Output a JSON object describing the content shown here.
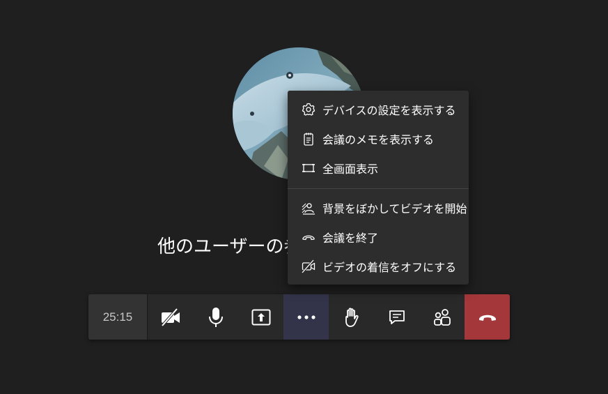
{
  "call": {
    "waiting_text": "他のユーザーの参",
    "timer": "25:15"
  },
  "toolbar": {
    "buttons": [
      {
        "name": "camera-off-button",
        "icon": "video-off-icon"
      },
      {
        "name": "microphone-button",
        "icon": "microphone-icon"
      },
      {
        "name": "share-screen-button",
        "icon": "share-screen-icon"
      },
      {
        "name": "more-actions-button",
        "icon": "more-dots-icon",
        "active": true
      },
      {
        "name": "raise-hand-button",
        "icon": "hand-icon"
      },
      {
        "name": "chat-button",
        "icon": "chat-icon"
      },
      {
        "name": "participants-button",
        "icon": "participants-icon"
      },
      {
        "name": "hang-up-button",
        "icon": "phone-hangup-icon"
      }
    ],
    "colors": {
      "active_bg": "#33344a",
      "hangup_bg": "#a4373a"
    }
  },
  "menu": {
    "items": [
      {
        "label": "デバイスの設定を表示する",
        "icon": "gear-icon"
      },
      {
        "label": "会議のメモを表示する",
        "icon": "notepad-icon"
      },
      {
        "label": "全画面表示",
        "icon": "fullscreen-icon"
      },
      {
        "label": "背景をぼかしてビデオを開始",
        "icon": "blur-background-icon"
      },
      {
        "label": "会議を終了",
        "icon": "end-call-icon"
      },
      {
        "label": "ビデオの着信をオフにする",
        "icon": "video-off-icon"
      }
    ]
  }
}
